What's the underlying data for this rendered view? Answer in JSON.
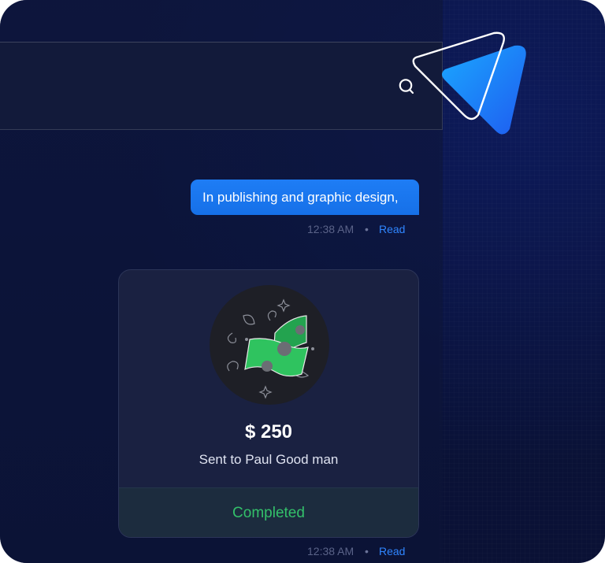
{
  "colors": {
    "background": "#0a1238",
    "accent": "#1e7df5",
    "read_status": "#2f86ff",
    "completed": "#33c06a",
    "card": "#1a2141"
  },
  "header": {
    "search_icon": "search-icon",
    "logo_icon": "triangle-logo-icon"
  },
  "messages": [
    {
      "text": "In publishing and graphic design,",
      "time": "12:38 AM",
      "separator": "•",
      "status": "Read"
    }
  ],
  "payment": {
    "illustration_icon": "money-bills-icon",
    "amount": "$ 250",
    "recipient": "Sent to Paul Good man",
    "status": "Completed",
    "time": "12:38 AM",
    "separator": "•",
    "read_status": "Read"
  }
}
